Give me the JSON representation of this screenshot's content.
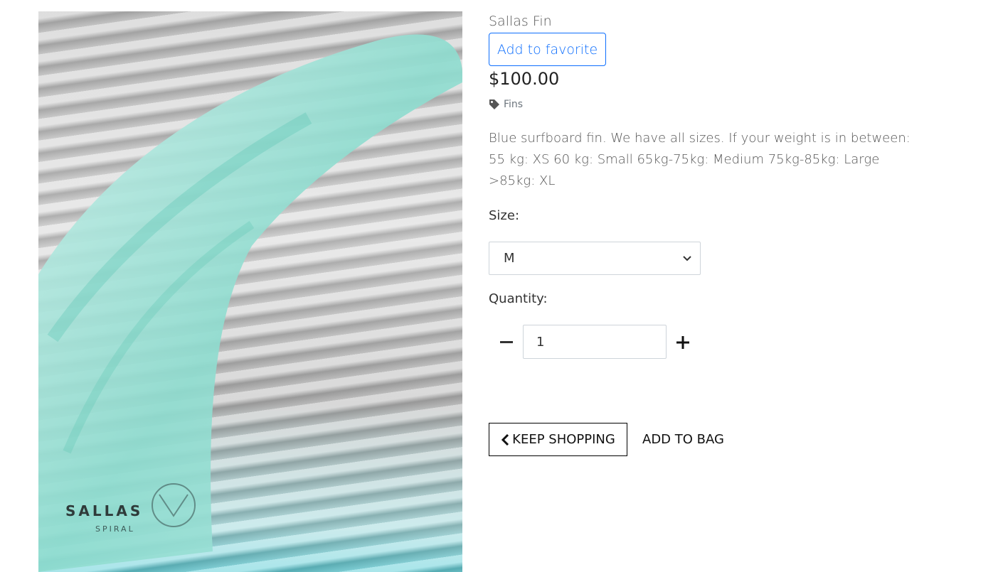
{
  "product": {
    "name": "Sallas Fin",
    "favorite_label": "Add to favorite",
    "price": "$100.00",
    "category": "Fins",
    "description": "Blue surfboard fin. We have all sizes. If your weight is in between: 55 kg: XS 60 kg: Small 65kg-75kg: Medium 75kg-85kg: Large >85kg: XL",
    "image_logo": "SALLAS",
    "image_sub": "SPIRAL"
  },
  "form": {
    "size_label": "Size:",
    "size_value": "M",
    "quantity_label": "Quantity:",
    "quantity_value": "1"
  },
  "actions": {
    "keep_shopping": "Keep Shopping",
    "add_to_bag": "Add to bag"
  },
  "colors": {
    "accent": "#0d6efd",
    "fin": "#9fe0d6"
  }
}
